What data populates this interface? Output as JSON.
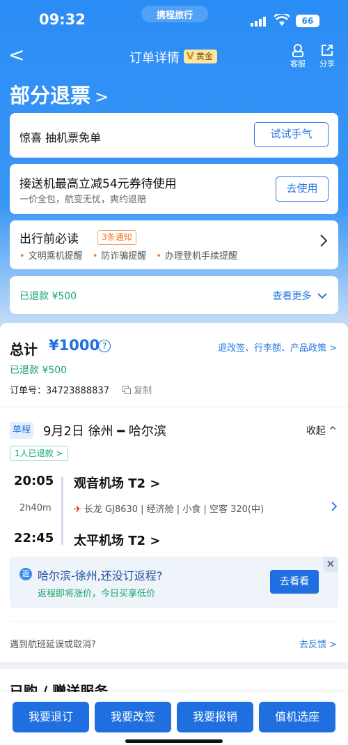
{
  "status": {
    "time": "09:32",
    "brand": "携程旅行",
    "battery": "66"
  },
  "nav": {
    "back": "<",
    "title": "订单详情",
    "member": "黄金",
    "service": "客服",
    "share": "分享"
  },
  "headline": {
    "text": "部分退票",
    "chev": ">"
  },
  "cards": {
    "surprise": {
      "text": "惊喜 抽机票免单",
      "button": "试试手气"
    },
    "transfer": {
      "title": "接送机最高立减54元券待使用",
      "subtitle": "一价全包，航变无忧，爽约退赔",
      "button": "去使用"
    },
    "notice": {
      "title": "出行前必读",
      "badge": "3条通知",
      "items": [
        "文明乘机提醒",
        "防诈骗提醒",
        "办理登机手续提醒"
      ]
    },
    "refund": {
      "amount": "已退款 ¥500",
      "more": "查看更多"
    }
  },
  "order": {
    "total_label": "总计",
    "total_value": "¥1000",
    "help": "?",
    "policy": "退改签、行李额、产品政策 >",
    "refunded": "已退款 ¥500",
    "order_no": "订单号：34723888837",
    "copy": "复制"
  },
  "flight": {
    "tag": "单程",
    "route": "9月2日 徐州 ━ 哈尔滨",
    "collapse": "收起 ^",
    "refund_count": "1人已退款 >",
    "dep_time": "20:05",
    "dep_airport": "观音机场 T2 >",
    "duration": "2h40m",
    "airline_info": "长龙 GJ8630 | 经济舱 | 小食 | 空客 320(中)",
    "arr_time": "22:45",
    "arr_airport": "太平机场 T2 >"
  },
  "promo": {
    "badge": "返",
    "title": "哈尔滨-徐州,还没订返程?",
    "subtitle": "返程即将涨价，今日买享低价",
    "button": "去看看"
  },
  "delay": {
    "text": "遇到航班延误或取消?",
    "link": "去反馈 >"
  },
  "services": {
    "title": "已购 / 赠送服务"
  },
  "bottom": {
    "refund": "我要退订",
    "change": "我要改签",
    "reimburse": "我要报销",
    "checkin": "值机选座"
  }
}
